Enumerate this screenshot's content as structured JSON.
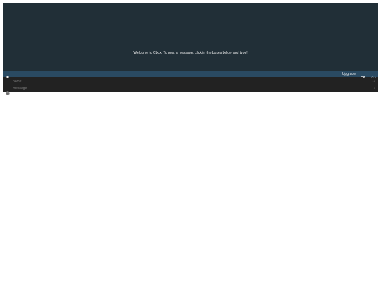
{
  "chat": {
    "welcome_text": "Welcome to Cbox! To post a message, click in the boxes below and type!"
  },
  "toolbar": {
    "user_icon": "user-icon",
    "upgrade_label": "Upgrade",
    "popout_icon": "external-link-icon",
    "info_icon": "info-icon"
  },
  "form": {
    "name_placeholder": "name",
    "name_counter": "16",
    "message_placeholder": "message",
    "message_counter": "0",
    "smiley_icon": "smiley-icon"
  },
  "colors": {
    "messages_bg": "#212f37",
    "toolbar_bg": "#2a4a62",
    "input_bg": "#222222"
  }
}
